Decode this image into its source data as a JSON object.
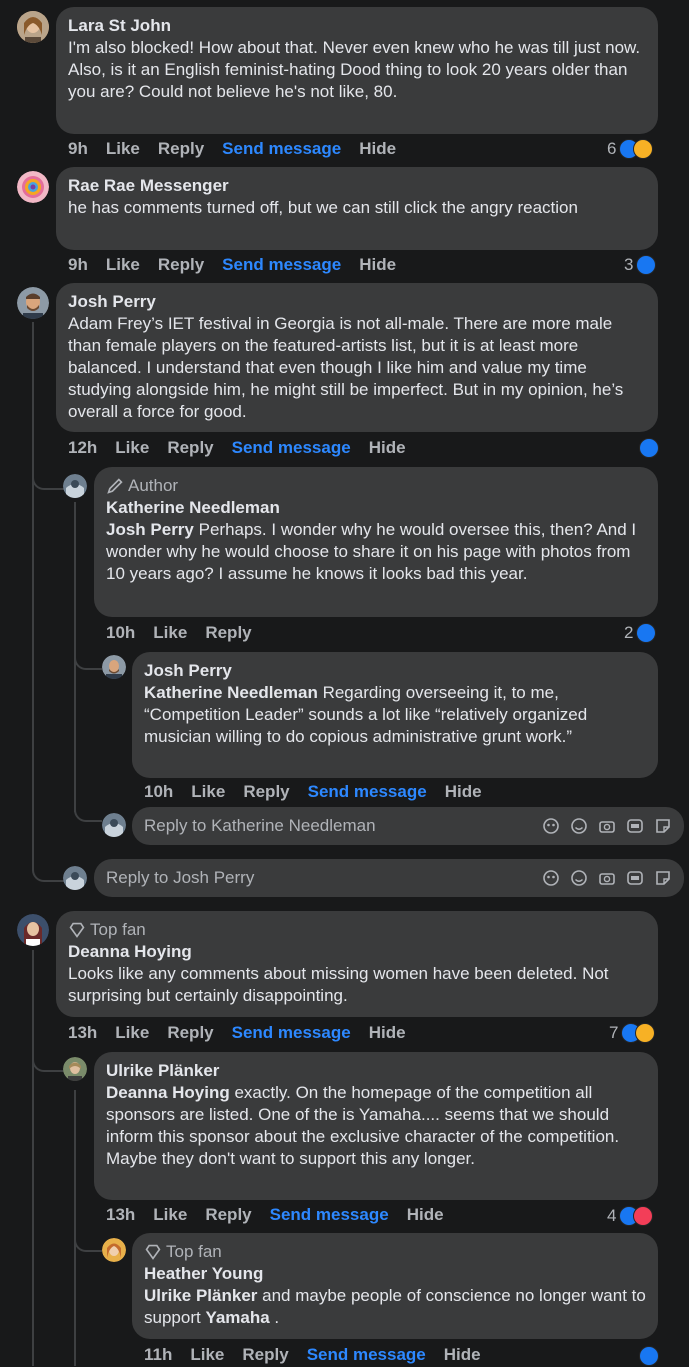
{
  "comments": [
    {
      "id": "c1",
      "author": "Lara St John",
      "text": "I'm also blocked! How about that. Never even knew who he was till just now. Also, is it an English feminist-hating Dood thing to look 20 years older than you are? Could not believe he's not like, 80.",
      "time": "9h",
      "like": "Like",
      "reply": "Reply",
      "send": "Send message",
      "hide": "Hide",
      "reaction_count": "6",
      "reactions": [
        "like-icon",
        "haha-icon"
      ]
    },
    {
      "id": "c2",
      "author": "Rae Rae Messenger",
      "text": "he has comments turned off, but we can still click the angry reaction",
      "time": "9h",
      "like": "Like",
      "reply": "Reply",
      "send": "Send message",
      "hide": "Hide",
      "reaction_count": "3",
      "reactions": [
        "like-icon"
      ]
    },
    {
      "id": "c3",
      "author": "Josh Perry",
      "text": "Adam Frey’s IET festival in Georgia is not all-male. There are more male than female players on the featured-artists list, but it is at least more balanced. I understand that even though I like him and value my time studying alongside him, he might still be imperfect. But in my opinion, he’s overall a force for good.",
      "time": "12h",
      "like": "Like",
      "reply": "Reply",
      "send": "Send message",
      "hide": "Hide",
      "reaction_count": "",
      "reactions": [
        "like-icon"
      ]
    },
    {
      "id": "c3r1",
      "badge": "Author",
      "author": "Katherine Needleman",
      "mention": "Josh Perry",
      "text": " Perhaps. I wonder why he would oversee this, then? And I wonder why he would choose to share it on his page with photos from 10 years ago? I assume he knows it looks bad this year.",
      "time": "10h",
      "like": "Like",
      "reply": "Reply",
      "reaction_count": "2",
      "reactions": [
        "like-icon"
      ]
    },
    {
      "id": "c3r2",
      "author": "Josh Perry",
      "mention": "Katherine Needleman",
      "text": " Regarding overseeing it, to me, “Competition Leader” sounds a lot like “relatively organized musician willing to do copious administrative grunt work.”",
      "time": "10h",
      "like": "Like",
      "reply": "Reply",
      "send": "Send message",
      "hide": "Hide"
    },
    {
      "id": "c4",
      "badge": "Top fan",
      "author": "Deanna Hoying",
      "text": "Looks like any comments about missing women have been deleted. Not surprising but certainly disappointing.",
      "time": "13h",
      "like": "Like",
      "reply": "Reply",
      "send": "Send message",
      "hide": "Hide",
      "reaction_count": "7",
      "reactions": [
        "like-icon",
        "sad-icon"
      ]
    },
    {
      "id": "c4r1",
      "author": "Ulrike Plänker",
      "mention": "Deanna Hoying",
      "text": " exactly. On the homepage of the competition all sponsors are listed. One of the is Yamaha.... seems that we should inform this sponsor about the exclusive character of the competition. Maybe they don't want to support this any longer.",
      "time": "13h",
      "like": "Like",
      "reply": "Reply",
      "send": "Send message",
      "hide": "Hide",
      "reaction_count": "4",
      "reactions": [
        "like-icon",
        "love-icon"
      ]
    },
    {
      "id": "c4r2",
      "badge": "Top fan",
      "author": "Heather Young",
      "mention": "Ulrike Plänker",
      "text": " and maybe people of conscience no longer want to support ",
      "mention2": "Yamaha",
      "text2": " .",
      "time": "11h",
      "like": "Like",
      "reply": "Reply",
      "send": "Send message",
      "hide": "Hide",
      "reaction_count": "",
      "reactions": [
        "like-icon"
      ]
    }
  ],
  "reply_boxes": {
    "katherine": "Reply to Katherine Needleman",
    "josh": "Reply to Josh Perry"
  },
  "composer_icons": [
    "avatar-sticker-icon",
    "emoji-icon",
    "camera-icon",
    "gif-icon",
    "sticker-icon"
  ],
  "colors": {
    "background": "#18191a",
    "bubble": "#3a3b3c",
    "text": "#e4e6eb",
    "secondary": "#b0b3b8",
    "link_blue": "#2d88ff",
    "like_blue": "#1877f2"
  }
}
